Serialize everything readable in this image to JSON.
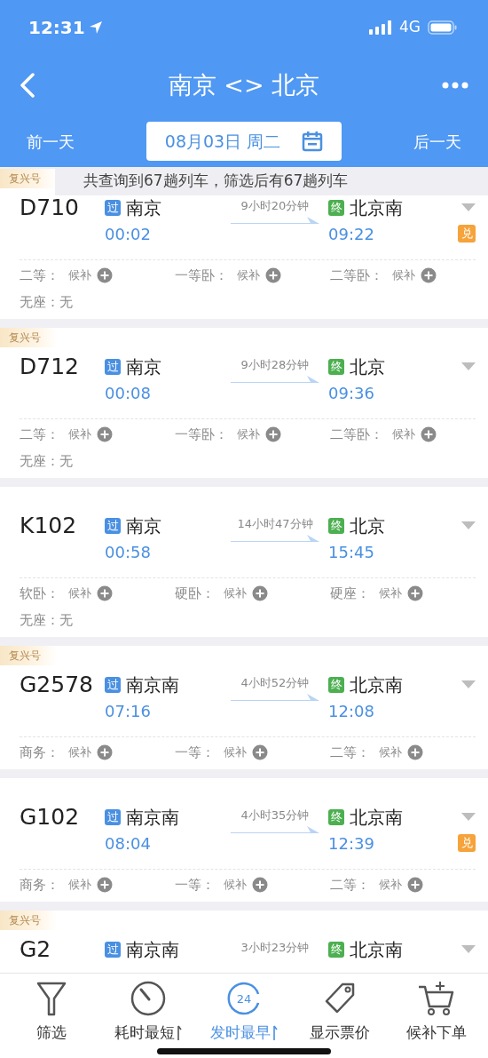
{
  "status_bar": {
    "time": "12:31",
    "network": "4G"
  },
  "nav": {
    "title": "南京 <> 北京"
  },
  "date_bar": {
    "prev": "前一天",
    "date": "08月03日 周二",
    "next": "后一天"
  },
  "notice": "共查询到67趟列车，筛选后有67趟列车",
  "trains": [
    {
      "badge": "复兴号",
      "code": "D710",
      "from": {
        "tag": "过",
        "station": "南京",
        "time": "00:02"
      },
      "duration": "9小时20分钟",
      "to": {
        "tag": "终",
        "station": "北京南",
        "time": "09:22"
      },
      "exchange": "兑",
      "seats": [
        {
          "label": "二等：",
          "value": "候补",
          "kind": "waitlist"
        },
        {
          "label": "一等卧：",
          "value": "候补",
          "kind": "waitlist"
        },
        {
          "label": "二等卧：",
          "value": "候补",
          "kind": "waitlist"
        },
        {
          "label": "无座：",
          "value": "无",
          "kind": "plain"
        }
      ]
    },
    {
      "badge": "复兴号",
      "code": "D712",
      "from": {
        "tag": "过",
        "station": "南京",
        "time": "00:08"
      },
      "duration": "9小时28分钟",
      "to": {
        "tag": "终",
        "station": "北京",
        "time": "09:36"
      },
      "seats": [
        {
          "label": "二等：",
          "value": "候补",
          "kind": "waitlist"
        },
        {
          "label": "一等卧：",
          "value": "候补",
          "kind": "waitlist"
        },
        {
          "label": "二等卧：",
          "value": "候补",
          "kind": "waitlist"
        },
        {
          "label": "无座：",
          "value": "无",
          "kind": "plain"
        }
      ]
    },
    {
      "code": "K102",
      "from": {
        "tag": "过",
        "station": "南京",
        "time": "00:58"
      },
      "duration": "14小时47分钟",
      "to": {
        "tag": "终",
        "station": "北京",
        "time": "15:45"
      },
      "seats": [
        {
          "label": "软卧：",
          "value": "候补",
          "kind": "waitlist"
        },
        {
          "label": "硬卧：",
          "value": "候补",
          "kind": "waitlist"
        },
        {
          "label": "硬座：",
          "value": "候补",
          "kind": "waitlist"
        },
        {
          "label": "无座：",
          "value": "无",
          "kind": "plain"
        }
      ]
    },
    {
      "badge": "复兴号",
      "code": "G2578",
      "from": {
        "tag": "过",
        "station": "南京南",
        "time": "07:16"
      },
      "duration": "4小时52分钟",
      "to": {
        "tag": "终",
        "station": "北京南",
        "time": "12:08"
      },
      "seats": [
        {
          "label": "商务：",
          "value": "候补",
          "kind": "waitlist"
        },
        {
          "label": "一等：",
          "value": "候补",
          "kind": "waitlist"
        },
        {
          "label": "二等：",
          "value": "候补",
          "kind": "waitlist"
        }
      ]
    },
    {
      "code": "G102",
      "from": {
        "tag": "过",
        "station": "南京南",
        "time": "08:04"
      },
      "duration": "4小时35分钟",
      "to": {
        "tag": "终",
        "station": "北京南",
        "time": "12:39"
      },
      "exchange": "兑",
      "seats": [
        {
          "label": "商务：",
          "value": "候补",
          "kind": "waitlist"
        },
        {
          "label": "一等：",
          "value": "候补",
          "kind": "waitlist"
        },
        {
          "label": "二等：",
          "value": "候补",
          "kind": "waitlist"
        }
      ]
    },
    {
      "badge": "复兴号",
      "code": "G2",
      "from": {
        "tag": "过",
        "station": "南京南"
      },
      "duration": "3小时23分钟",
      "to": {
        "tag": "终",
        "station": "北京南"
      }
    }
  ],
  "toolbar": [
    {
      "label": "筛选",
      "kind": "filter",
      "selected": false,
      "sort_indicator": false
    },
    {
      "label": "耗时最短",
      "kind": "timer",
      "selected": false,
      "sort_indicator": true
    },
    {
      "label": "发时最早",
      "kind": "clock",
      "icon_text": "24",
      "selected": true,
      "sort_indicator": true
    },
    {
      "label": "显示票价",
      "kind": "price",
      "selected": false,
      "sort_indicator": false
    },
    {
      "label": "候补下单",
      "kind": "cart",
      "selected": false,
      "sort_indicator": false
    }
  ]
}
